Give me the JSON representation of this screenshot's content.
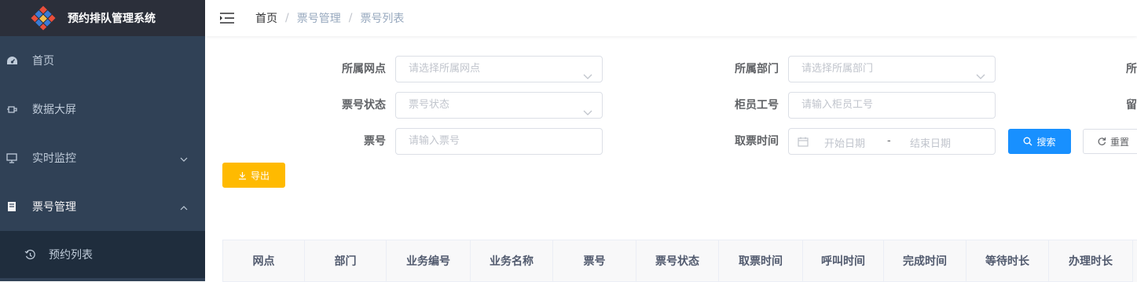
{
  "app": {
    "title": "预约排队管理系统"
  },
  "sidebar": {
    "items": [
      {
        "label": "首页",
        "icon": "dashboard-icon"
      },
      {
        "label": "数据大屏",
        "icon": "screen-icon"
      },
      {
        "label": "实时监控",
        "icon": "monitor-icon"
      },
      {
        "label": "票号管理",
        "icon": "ticket-icon"
      }
    ],
    "sub_items": [
      {
        "label": "预约列表",
        "icon": "history-icon"
      }
    ]
  },
  "breadcrumb": {
    "home": "首页",
    "level1": "票号管理",
    "level2": "票号列表"
  },
  "filters": {
    "branch": {
      "label": "所属网点",
      "placeholder": "请选择所属网点"
    },
    "department": {
      "label": "所属部门",
      "placeholder": "请选择所属部门"
    },
    "third_label": "所",
    "ticket_status": {
      "label": "票号状态",
      "placeholder": "票号状态"
    },
    "teller": {
      "label": "柜员工号",
      "placeholder": "请输入柜员工号"
    },
    "third_label_2": "留",
    "ticket_no": {
      "label": "票号",
      "placeholder": "请输入票号"
    },
    "take_time": {
      "label": "取票时间",
      "start_placeholder": "开始日期",
      "separator": "-",
      "end_placeholder": "结束日期"
    }
  },
  "buttons": {
    "search": "搜索",
    "reset": "重置",
    "export": "导出"
  },
  "table": {
    "columns": [
      "网点",
      "部门",
      "业务编号",
      "业务名称",
      "票号",
      "票号状态",
      "取票时间",
      "呼叫时间",
      "完成时间",
      "等待时长",
      "办理时长"
    ]
  },
  "colors": {
    "sidebar": "#304156",
    "primary": "#1890ff",
    "warning": "#ffba00"
  }
}
